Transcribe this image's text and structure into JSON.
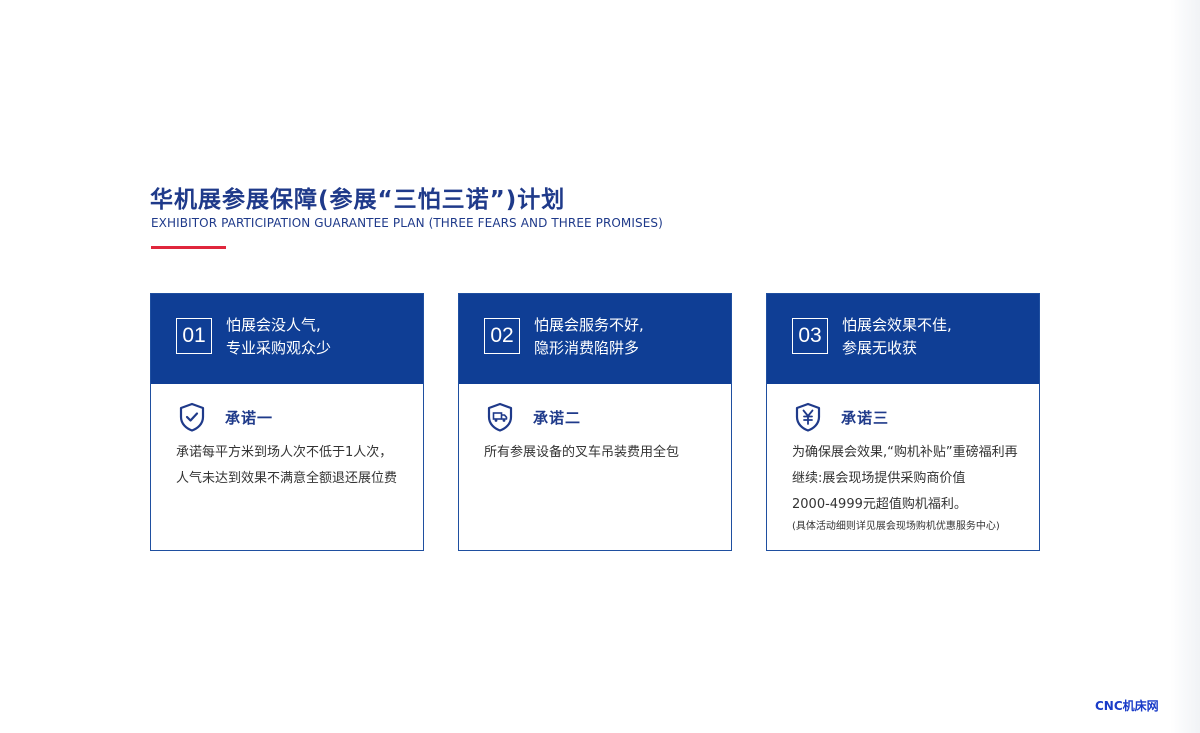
{
  "heading": {
    "title_cn": "华机展参展保障(参展“三怕三诺”)计划",
    "title_en": "EXHIBITOR PARTICIPATION GUARANTEE PLAN (THREE FEARS AND THREE PROMISES)"
  },
  "cards": [
    {
      "number": "01",
      "fear_line1": "怕展会没人气,",
      "fear_line2": "专业采购观众少",
      "icon": "shield-check-icon",
      "promise_title": "承诺一",
      "lines": [
        "承诺每平方米到场人次不低于1人次，",
        "人气未达到效果不满意全额退还展位费"
      ],
      "note": ""
    },
    {
      "number": "02",
      "fear_line1": "怕展会服务不好,",
      "fear_line2": "隐形消费陷阱多",
      "icon": "shield-truck-icon",
      "promise_title": "承诺二",
      "lines": [
        "所有参展设备的叉车吊装费用全包"
      ],
      "note": ""
    },
    {
      "number": "03",
      "fear_line1": "怕展会效果不佳,",
      "fear_line2": "参展无收获",
      "icon": "shield-yen-icon",
      "promise_title": "承诺三",
      "lines": [
        "为确保展会效果,“购机补贴”重磅福利再",
        "继续:展会现场提供采购商价值",
        "2000-4999元超值购机福利。"
      ],
      "note": "(具体活动细则详见展会现场购机优惠服务中心)"
    }
  ],
  "watermark": "CNC机床网",
  "colors": {
    "primary": "#0f3e95",
    "accent": "#e0263c",
    "brand": "#1a3cc8"
  }
}
